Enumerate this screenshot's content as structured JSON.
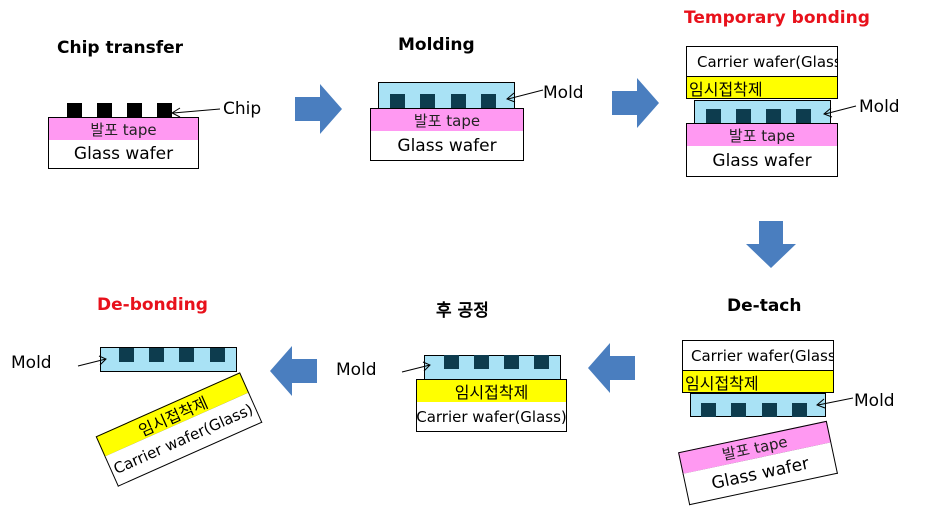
{
  "steps": {
    "chip_transfer": {
      "title": "Chip transfer",
      "tape": "발포 tape",
      "glass": "Glass wafer",
      "chip_label": "Chip"
    },
    "molding": {
      "title": "Molding",
      "tape": "발포 tape",
      "glass": "Glass wafer",
      "mold_label": "Mold"
    },
    "temporary_bonding": {
      "title": "Temporary bonding",
      "carrier": "Carrier wafer(Glass)",
      "adhesive": "임시접착제",
      "tape": "발포 tape",
      "glass": "Glass wafer",
      "mold_label": "Mold"
    },
    "de_tach": {
      "title": "De-tach",
      "carrier": "Carrier wafer(Glass)",
      "adhesive": "임시접착제",
      "tape": "발포 tape",
      "glass": "Glass wafer",
      "mold_label": "Mold"
    },
    "post_process": {
      "title": "후 공정",
      "adhesive": "임시접착제",
      "carrier": "Carrier wafer(Glass)",
      "mold_label": "Mold"
    },
    "de_bonding": {
      "title": "De-bonding",
      "adhesive": "임시접착제",
      "carrier": "Carrier wafer(Glass)",
      "mold_label": "Mold"
    }
  },
  "colors": {
    "highlight_title": "#e8111b",
    "tape": "#ff99f2",
    "mold": "#a9e2f5",
    "adhesive": "#ffff00",
    "chip": "#0d3c4e",
    "arrow": "#4a7ebf"
  },
  "flow_arrows": [
    "right",
    "right",
    "down",
    "left",
    "left"
  ]
}
